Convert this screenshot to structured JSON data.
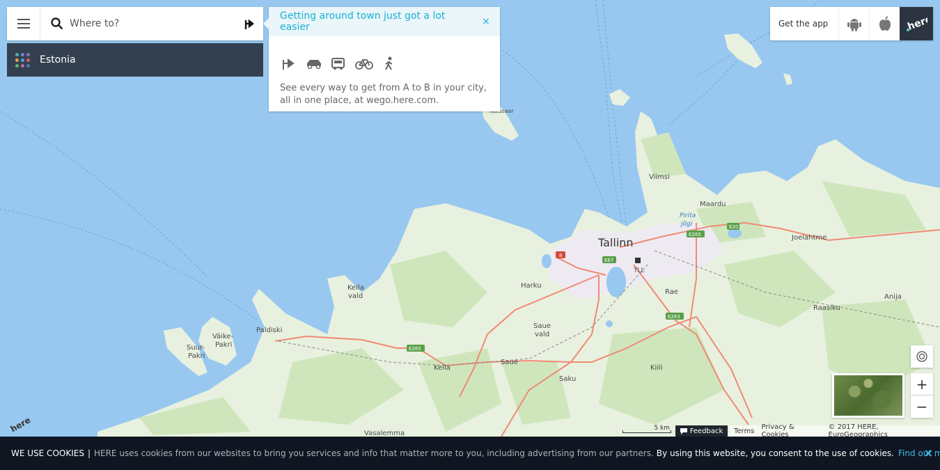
{
  "search": {
    "placeholder": "Where to?"
  },
  "country": {
    "name": "Estonia"
  },
  "promo": {
    "title": "Getting around town just got a lot easier",
    "close": "×",
    "text": "See every way to get from A to B in your city, all in one place, at wego.here.com.",
    "modes": [
      "directions-icon",
      "car-icon",
      "transit-icon",
      "bike-icon",
      "walk-icon"
    ]
  },
  "app": {
    "label": "Get the app",
    "platforms": [
      "android-icon",
      "apple-icon"
    ],
    "brand": "here"
  },
  "map": {
    "places": {
      "tallinn": "Tallinn",
      "viimsi": "Viimsi",
      "maardu": "Maardu",
      "joelahtme": "Joelahtme",
      "harku": "Harku",
      "keila_vald_1": "Keila",
      "keila_vald_2": "vald",
      "paldiski": "Paldiski",
      "vaike_1": "Väike-",
      "vaike_2": "Pakri",
      "suur_1": "Suur-",
      "suur_2": "Pakri",
      "saue_vald_1": "Saue",
      "saue_vald_2": "vald",
      "saue": "Saue",
      "keila": "Keila",
      "saku": "Saku",
      "kiili": "Kiili",
      "rae": "Rae",
      "raasiku": "Raasiku",
      "anija": "Anija",
      "vasalemma": "Vasalemma",
      "naissaar": "Naissaar",
      "tll": "TLL",
      "pirita_1": "Pirita",
      "pirita_2": "jõgi"
    },
    "roads": [
      "E20",
      "E265",
      "E67",
      "E263",
      "E265",
      "8"
    ]
  },
  "controls": {
    "zoom_in": "+",
    "zoom_out": "−"
  },
  "scale": {
    "label": "5 km"
  },
  "footer": {
    "feedback": "Feedback",
    "terms": "Terms",
    "privacy": "Privacy & Cookies",
    "copyright": "© 2017 HERE, EuroGeographics"
  },
  "cookie": {
    "heading": "WE USE COOKIES",
    "separator": "|",
    "body": "HERE uses cookies from our websites to bring you services and info that matter more to you, including advertising from our partners.",
    "consent": "By using this website, you consent to the use of cookies.",
    "link": "Find out more",
    "close": "×"
  },
  "colors": {
    "accent": "#1ab0d3",
    "water": "#98c8f0",
    "land": "#e8f1df",
    "forest": "#cfe6bd",
    "road": "#f08a73",
    "dark": "#0f1621"
  }
}
